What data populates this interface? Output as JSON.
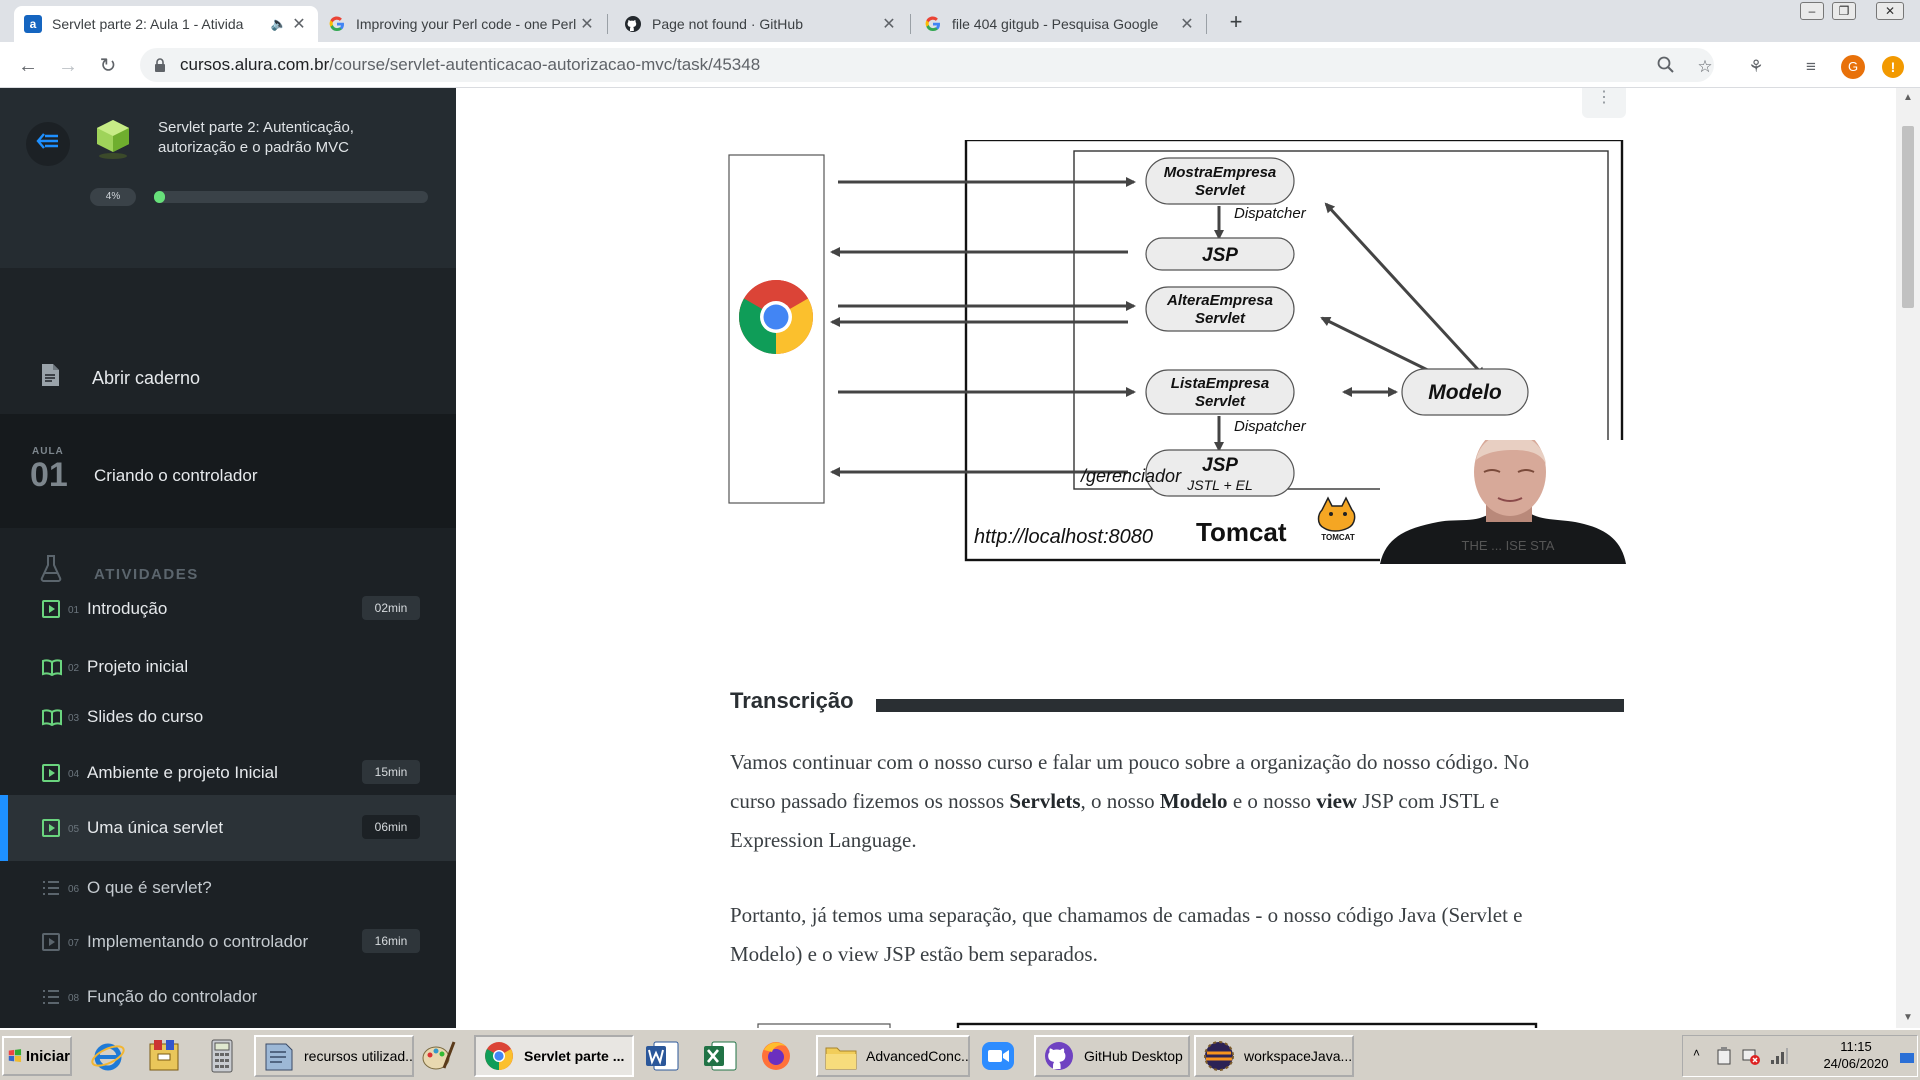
{
  "browser": {
    "tabs": [
      {
        "title": "Servlet parte 2: Aula 1 - Ativida",
        "favicon": "alura-icon",
        "active": true,
        "audio": true
      },
      {
        "title": "Improving your Perl code - one Perl",
        "favicon": "google-icon"
      },
      {
        "title": "Page not found · GitHub",
        "favicon": "github-icon"
      },
      {
        "title": "file 404 gitgub - Pesquisa Google",
        "favicon": "google-icon"
      }
    ],
    "new_tab": "+",
    "url_host": "cursos.alura.com.br",
    "url_path": "/course/servlet-autenticacao-autorizacao-mvc/task/45348",
    "profile_initial": "G",
    "alert_glyph": "!"
  },
  "sidebar": {
    "course_title": "Servlet parte 2: Autenticação, autorização e o padrão MVC",
    "progress_label": "4%",
    "progress_value": 0.04,
    "notebook_label": "Abrir caderno",
    "aula_tag": "AULA",
    "aula_number": "01",
    "aula_title": "Criando o controlador",
    "activities_label": "ATIVIDADES",
    "activities": [
      {
        "num": "01",
        "title": "Introdução",
        "duration": "02min",
        "icon": "video-icon"
      },
      {
        "num": "02",
        "title": "Projeto inicial",
        "duration": "",
        "icon": "book-icon"
      },
      {
        "num": "03",
        "title": "Slides do curso",
        "duration": "",
        "icon": "book-icon"
      },
      {
        "num": "04",
        "title": "Ambiente e projeto Inicial",
        "duration": "15min",
        "icon": "video-icon"
      },
      {
        "num": "05",
        "title": "Uma única servlet",
        "duration": "06min",
        "icon": "video-icon",
        "current": true
      },
      {
        "num": "06",
        "title": "O que é servlet?",
        "duration": "",
        "icon": "list-icon",
        "dim": true
      },
      {
        "num": "07",
        "title": "Implementando o controlador",
        "duration": "16min",
        "icon": "video-icon",
        "dim": true
      },
      {
        "num": "08",
        "title": "Função do controlador",
        "duration": "",
        "icon": "list-icon",
        "dim": true
      }
    ]
  },
  "diagram": {
    "servlet1": [
      "MostraEmpresa",
      "Servlet"
    ],
    "dispatcher1": "Dispatcher",
    "jsp1": "JSP",
    "servlet2": [
      "AlteraEmpresa",
      "Servlet"
    ],
    "servlet3": [
      "ListaEmpresa",
      "Servlet"
    ],
    "modelo": "Modelo",
    "dispatcher2": "Dispatcher",
    "jsp2": "JSP",
    "jsp2_sub": "JSTL + EL",
    "context": "/gerenciador",
    "url": "http://localhost:8080",
    "server": "Tomcat",
    "server_logo_text": "TOMCAT",
    "shirt_text": "THE ... ISE STA"
  },
  "content": {
    "transcription_label": "Transcrição",
    "para1": [
      {
        "t": "Vamos continuar com o nosso curso e falar um pouco sobre a organização do nosso código. No curso passado fizemos os nossos "
      },
      {
        "t": "Servlets",
        "b": true
      },
      {
        "t": ", o nosso "
      },
      {
        "t": "Modelo",
        "b": true
      },
      {
        "t": " e o nosso "
      },
      {
        "t": "view",
        "b": true
      },
      {
        "t": " JSP com JSTL e Expression Language."
      }
    ],
    "para2": "Portanto, já temos uma separação, que chamamos de camadas - o nosso código Java (Servlet e Modelo) e o view JSP estão bem separados."
  },
  "taskbar": {
    "start_label": "Iniciar",
    "tasks": [
      {
        "label": "recursos utilizad...",
        "icon": "notepad-icon"
      },
      {
        "label": "Servlet parte ...",
        "icon": "chrome-icon",
        "pressed": true
      },
      {
        "label": "AdvancedConc...",
        "icon": "folder-icon"
      },
      {
        "label": "GitHub Desktop",
        "icon": "github-desktop-icon"
      },
      {
        "label": "workspaceJava...",
        "icon": "eclipse-icon"
      }
    ],
    "time": "11:15",
    "date": "24/06/2020"
  },
  "colors": {
    "sidebar_bg": "#1c2125",
    "accent_blue": "#1e90ff",
    "progress_green": "#67e07a",
    "activity_icon_green": "#6ad47e"
  }
}
